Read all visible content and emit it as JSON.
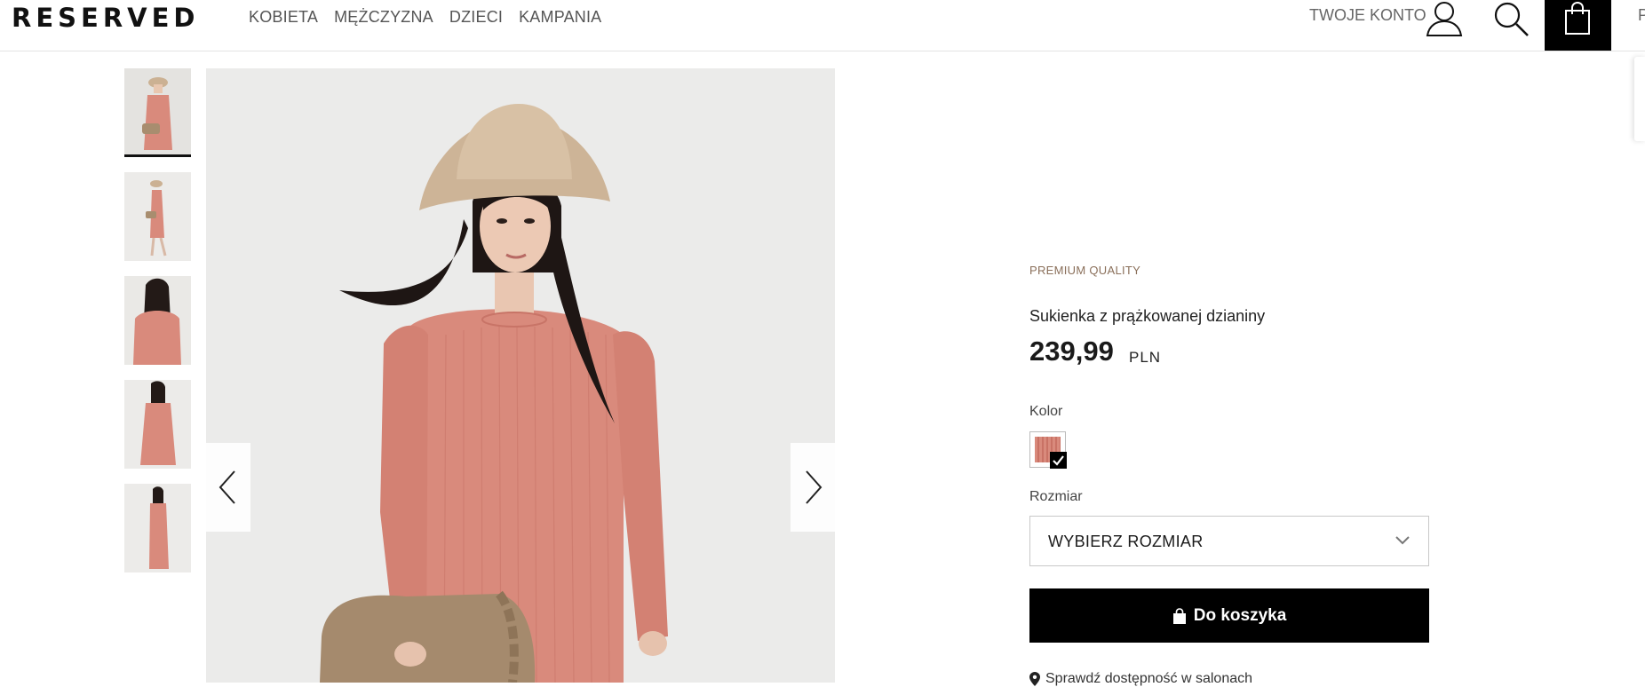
{
  "header": {
    "logo": "RESERVED",
    "nav": [
      "KOBIETA",
      "MĘŻCZYZNA",
      "DZIECI",
      "KAMPANIA"
    ],
    "account_label": "TWOJE KONTO",
    "edge_text": "P",
    "icons": [
      "user-icon",
      "search-icon",
      "shopping-bag-icon"
    ]
  },
  "gallery": {
    "thumbnail_count": 5,
    "active_index": 0,
    "icons": [
      "chevron-left-icon",
      "chevron-right-icon"
    ]
  },
  "product": {
    "badge": "PREMIUM QUALITY",
    "name": "Sukienka z prążkowanej dzianiny",
    "price": "239,99",
    "currency": "PLN",
    "color_label": "Kolor",
    "size_label": "Rozmiar",
    "size_placeholder": "WYBIERZ ROZMIAR",
    "add_to_cart": "Do koszyka",
    "store_availability": "Sprawdź dostępność w salonach"
  },
  "colors": {
    "brand_black": "#000000",
    "dress": "#d98a7c",
    "badge_text": "#8a6f5a"
  }
}
